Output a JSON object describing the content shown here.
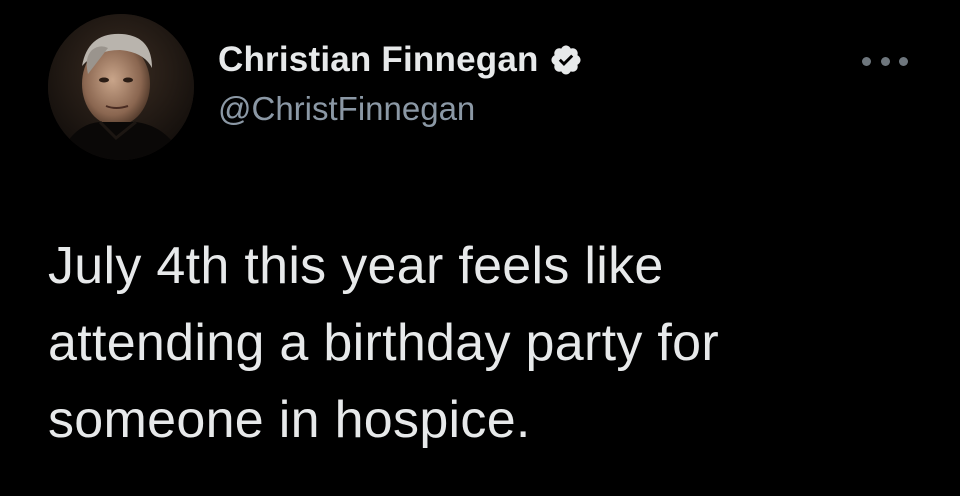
{
  "author": {
    "display_name": "Christian Finnegan",
    "handle": "@ChristFinnegan",
    "verified": true,
    "avatar_icon": "profile-photo"
  },
  "tweet": {
    "text_lines": [
      "July 4th this year feels like",
      "attending a birthday party for",
      "someone in hospice."
    ]
  },
  "colors": {
    "background": "#000000",
    "name": "#e7e9ea",
    "handle": "#8b98a5",
    "verified_badge": "#e7e9ea"
  },
  "icons": {
    "verified": "verified-badge-icon",
    "more": "more-options-icon"
  }
}
